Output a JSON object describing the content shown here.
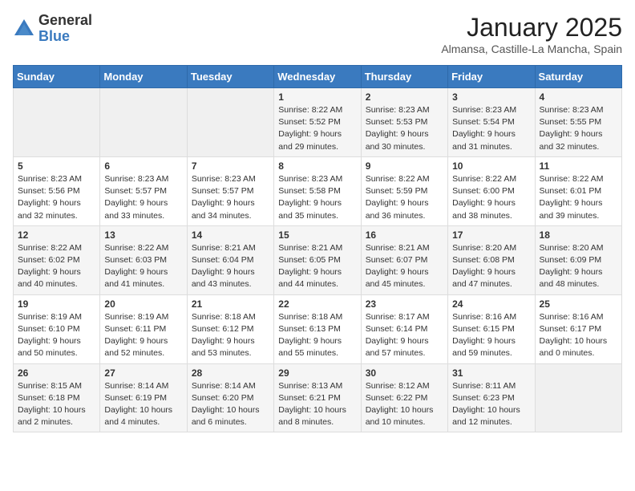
{
  "header": {
    "logo": {
      "text1": "General",
      "text2": "Blue"
    },
    "title": "January 2025",
    "location": "Almansa, Castille-La Mancha, Spain"
  },
  "days_of_week": [
    "Sunday",
    "Monday",
    "Tuesday",
    "Wednesday",
    "Thursday",
    "Friday",
    "Saturday"
  ],
  "weeks": [
    [
      {
        "num": "",
        "info": ""
      },
      {
        "num": "",
        "info": ""
      },
      {
        "num": "",
        "info": ""
      },
      {
        "num": "1",
        "info": "Sunrise: 8:22 AM\nSunset: 5:52 PM\nDaylight: 9 hours\nand 29 minutes."
      },
      {
        "num": "2",
        "info": "Sunrise: 8:23 AM\nSunset: 5:53 PM\nDaylight: 9 hours\nand 30 minutes."
      },
      {
        "num": "3",
        "info": "Sunrise: 8:23 AM\nSunset: 5:54 PM\nDaylight: 9 hours\nand 31 minutes."
      },
      {
        "num": "4",
        "info": "Sunrise: 8:23 AM\nSunset: 5:55 PM\nDaylight: 9 hours\nand 32 minutes."
      }
    ],
    [
      {
        "num": "5",
        "info": "Sunrise: 8:23 AM\nSunset: 5:56 PM\nDaylight: 9 hours\nand 32 minutes."
      },
      {
        "num": "6",
        "info": "Sunrise: 8:23 AM\nSunset: 5:57 PM\nDaylight: 9 hours\nand 33 minutes."
      },
      {
        "num": "7",
        "info": "Sunrise: 8:23 AM\nSunset: 5:57 PM\nDaylight: 9 hours\nand 34 minutes."
      },
      {
        "num": "8",
        "info": "Sunrise: 8:23 AM\nSunset: 5:58 PM\nDaylight: 9 hours\nand 35 minutes."
      },
      {
        "num": "9",
        "info": "Sunrise: 8:22 AM\nSunset: 5:59 PM\nDaylight: 9 hours\nand 36 minutes."
      },
      {
        "num": "10",
        "info": "Sunrise: 8:22 AM\nSunset: 6:00 PM\nDaylight: 9 hours\nand 38 minutes."
      },
      {
        "num": "11",
        "info": "Sunrise: 8:22 AM\nSunset: 6:01 PM\nDaylight: 9 hours\nand 39 minutes."
      }
    ],
    [
      {
        "num": "12",
        "info": "Sunrise: 8:22 AM\nSunset: 6:02 PM\nDaylight: 9 hours\nand 40 minutes."
      },
      {
        "num": "13",
        "info": "Sunrise: 8:22 AM\nSunset: 6:03 PM\nDaylight: 9 hours\nand 41 minutes."
      },
      {
        "num": "14",
        "info": "Sunrise: 8:21 AM\nSunset: 6:04 PM\nDaylight: 9 hours\nand 43 minutes."
      },
      {
        "num": "15",
        "info": "Sunrise: 8:21 AM\nSunset: 6:05 PM\nDaylight: 9 hours\nand 44 minutes."
      },
      {
        "num": "16",
        "info": "Sunrise: 8:21 AM\nSunset: 6:07 PM\nDaylight: 9 hours\nand 45 minutes."
      },
      {
        "num": "17",
        "info": "Sunrise: 8:20 AM\nSunset: 6:08 PM\nDaylight: 9 hours\nand 47 minutes."
      },
      {
        "num": "18",
        "info": "Sunrise: 8:20 AM\nSunset: 6:09 PM\nDaylight: 9 hours\nand 48 minutes."
      }
    ],
    [
      {
        "num": "19",
        "info": "Sunrise: 8:19 AM\nSunset: 6:10 PM\nDaylight: 9 hours\nand 50 minutes."
      },
      {
        "num": "20",
        "info": "Sunrise: 8:19 AM\nSunset: 6:11 PM\nDaylight: 9 hours\nand 52 minutes."
      },
      {
        "num": "21",
        "info": "Sunrise: 8:18 AM\nSunset: 6:12 PM\nDaylight: 9 hours\nand 53 minutes."
      },
      {
        "num": "22",
        "info": "Sunrise: 8:18 AM\nSunset: 6:13 PM\nDaylight: 9 hours\nand 55 minutes."
      },
      {
        "num": "23",
        "info": "Sunrise: 8:17 AM\nSunset: 6:14 PM\nDaylight: 9 hours\nand 57 minutes."
      },
      {
        "num": "24",
        "info": "Sunrise: 8:16 AM\nSunset: 6:15 PM\nDaylight: 9 hours\nand 59 minutes."
      },
      {
        "num": "25",
        "info": "Sunrise: 8:16 AM\nSunset: 6:17 PM\nDaylight: 10 hours\nand 0 minutes."
      }
    ],
    [
      {
        "num": "26",
        "info": "Sunrise: 8:15 AM\nSunset: 6:18 PM\nDaylight: 10 hours\nand 2 minutes."
      },
      {
        "num": "27",
        "info": "Sunrise: 8:14 AM\nSunset: 6:19 PM\nDaylight: 10 hours\nand 4 minutes."
      },
      {
        "num": "28",
        "info": "Sunrise: 8:14 AM\nSunset: 6:20 PM\nDaylight: 10 hours\nand 6 minutes."
      },
      {
        "num": "29",
        "info": "Sunrise: 8:13 AM\nSunset: 6:21 PM\nDaylight: 10 hours\nand 8 minutes."
      },
      {
        "num": "30",
        "info": "Sunrise: 8:12 AM\nSunset: 6:22 PM\nDaylight: 10 hours\nand 10 minutes."
      },
      {
        "num": "31",
        "info": "Sunrise: 8:11 AM\nSunset: 6:23 PM\nDaylight: 10 hours\nand 12 minutes."
      },
      {
        "num": "",
        "info": ""
      }
    ]
  ]
}
